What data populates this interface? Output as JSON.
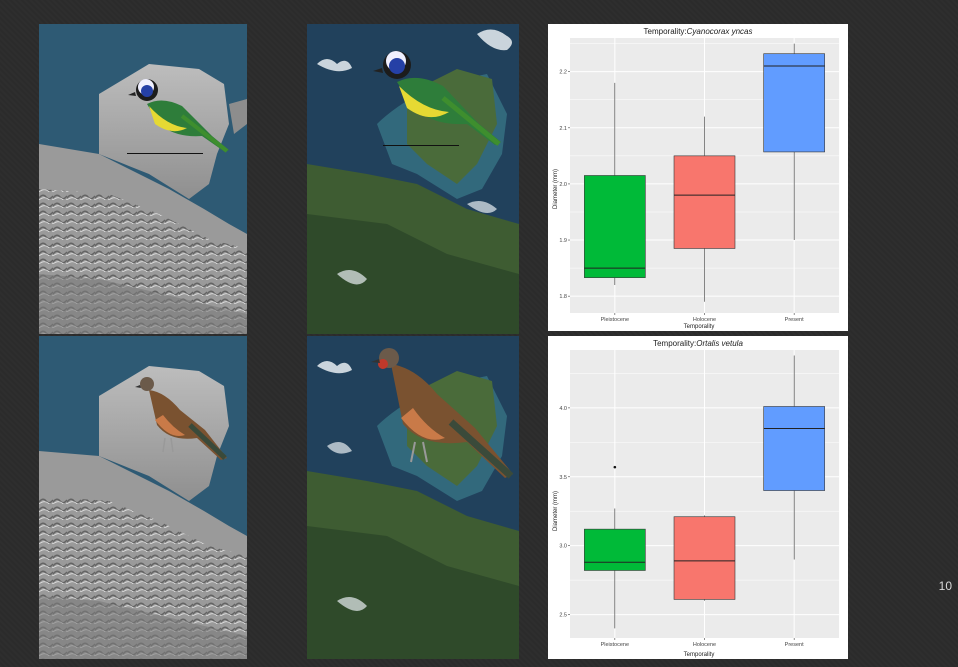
{
  "slide": {
    "page_number": "10"
  },
  "panels": {
    "relief_map_top": {
      "bird": "green-jay",
      "has_scale_bar": true
    },
    "satellite_map_top": {
      "bird": "green-jay",
      "has_scale_bar": true
    },
    "relief_map_bottom": {
      "bird": "plain-chachalaca"
    },
    "satellite_map_bottom": {
      "bird": "plain-chachalaca"
    }
  },
  "colors": {
    "pleistocene": "#00ba38",
    "holocene": "#f8766d",
    "present": "#619cff",
    "plot_bg": "#ebebeb",
    "grid": "#ffffff"
  },
  "chart_data": [
    {
      "type": "box",
      "title_prefix": "Temporality:",
      "title_species": "Cyanocorax yncas",
      "xlabel": "Temporality",
      "ylabel": "Diameter (mm)",
      "ylim": [
        1.77,
        2.26
      ],
      "yticks": [
        "1.8",
        "1.9",
        "2.0",
        "2.1",
        "2.2"
      ],
      "ytick_values": [
        1.8,
        1.9,
        2.0,
        2.1,
        2.2
      ],
      "categories": [
        "Pleistocene",
        "Holocene",
        "Present"
      ],
      "boxes": [
        {
          "category": "Pleistocene",
          "min": 1.82,
          "q1": 1.833,
          "median": 1.85,
          "q3": 2.015,
          "max": 2.18,
          "outliers": []
        },
        {
          "category": "Holocene",
          "min": 1.79,
          "q1": 1.885,
          "median": 1.98,
          "q3": 2.05,
          "max": 2.12,
          "outliers": []
        },
        {
          "category": "Present",
          "min": 1.9,
          "q1": 2.057,
          "median": 2.21,
          "q3": 2.232,
          "max": 2.25,
          "outliers": []
        }
      ]
    },
    {
      "type": "box",
      "title_prefix": "Temporality:",
      "title_species": "Ortalis vetula",
      "xlabel": "Temporality",
      "ylabel": "Diameter (mm)",
      "ylim": [
        2.33,
        4.42
      ],
      "yticks": [
        "2.5",
        "3.0",
        "3.5",
        "4.0"
      ],
      "ytick_values": [
        2.5,
        3.0,
        3.5,
        4.0
      ],
      "categories": [
        "Pleistocene",
        "Holocene",
        "Present"
      ],
      "boxes": [
        {
          "category": "Pleistocene",
          "min": 2.4,
          "q1": 2.82,
          "median": 2.88,
          "q3": 3.12,
          "max": 3.27,
          "outliers": [
            3.57
          ]
        },
        {
          "category": "Holocene",
          "min": 2.6,
          "q1": 2.61,
          "median": 2.89,
          "q3": 3.21,
          "max": 3.22,
          "outliers": []
        },
        {
          "category": "Present",
          "min": 2.9,
          "q1": 3.4,
          "median": 3.85,
          "q3": 4.01,
          "max": 4.38,
          "outliers": []
        }
      ]
    }
  ]
}
